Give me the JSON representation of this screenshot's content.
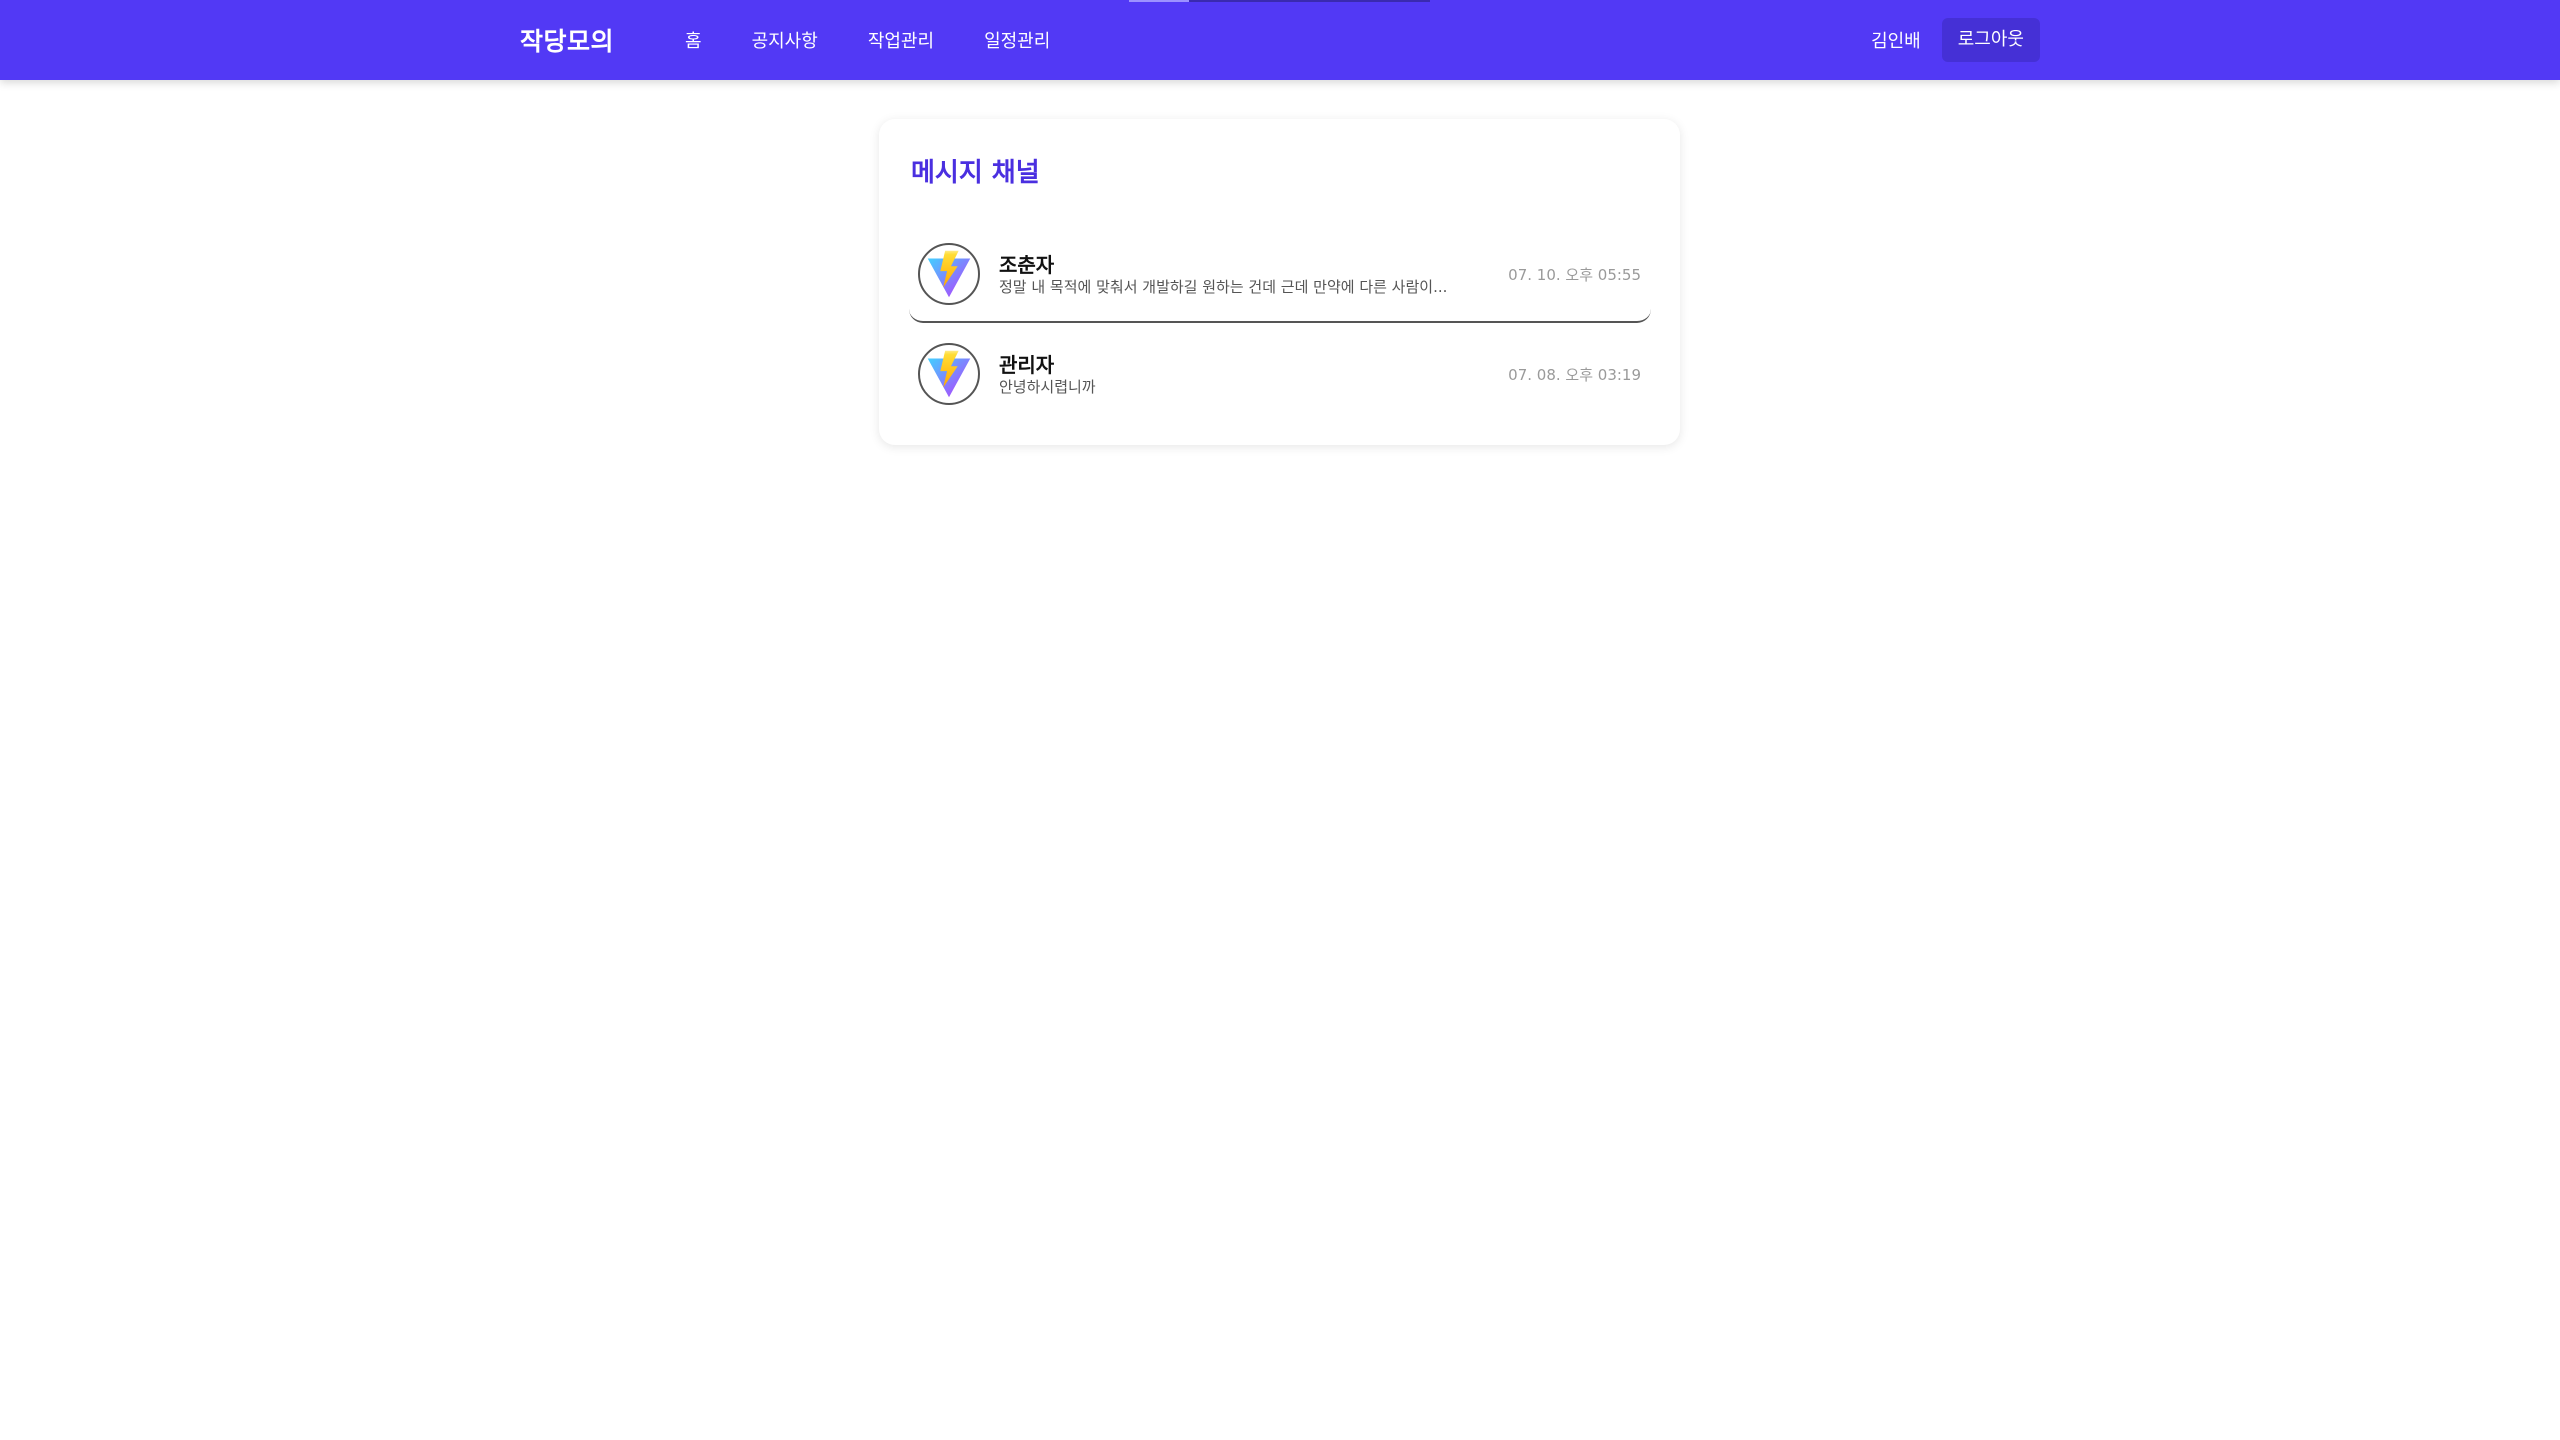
{
  "header": {
    "brand": "작당모의",
    "nav": [
      {
        "label": "홈"
      },
      {
        "label": "공지사항"
      },
      {
        "label": "작업관리"
      },
      {
        "label": "일정관리"
      }
    ],
    "username": "김인배",
    "logout_label": "로그아웃"
  },
  "main": {
    "title": "메시지 채널",
    "channels": [
      {
        "name": "조춘자",
        "preview": "정말 내 목적에 맞춰서 개발하길 원하는 건데 근데 만약에 다른 사람이...",
        "time": "07. 10. 오후 05:55",
        "avatar_icon": "vite-logo-icon",
        "selected": true
      },
      {
        "name": "관리자",
        "preview": "안녕하시렵니까",
        "time": "07. 08. 오후 03:19",
        "avatar_icon": "vite-logo-icon",
        "selected": false
      }
    ]
  },
  "colors": {
    "navbar": "#5239f5",
    "accent": "#4a2fe0",
    "logout_button": "#4530d6"
  }
}
